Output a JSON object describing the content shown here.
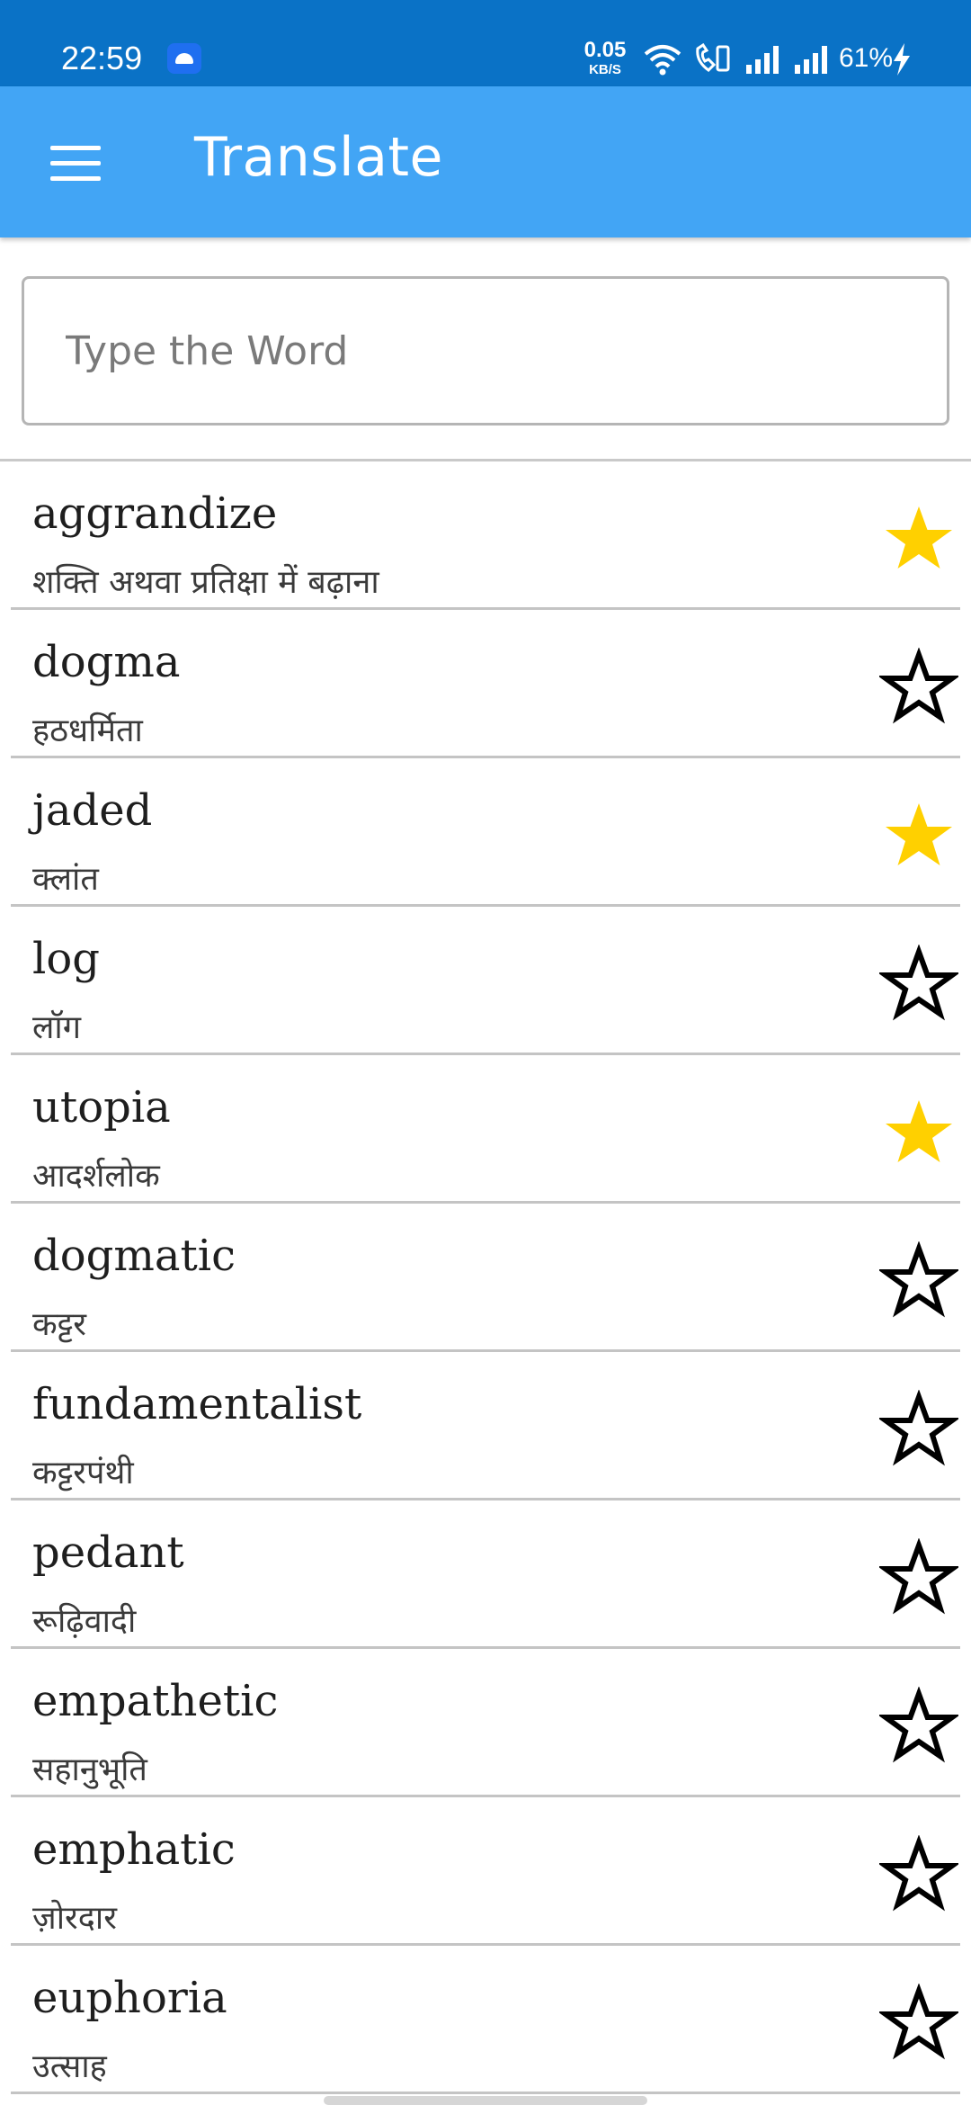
{
  "status_bar": {
    "time": "22:59",
    "speed_value": "0.05",
    "speed_unit": "KB/S",
    "battery": "61%"
  },
  "app_bar": {
    "title": "Translate",
    "menu_icon": "hamburger-menu-icon",
    "color": "#42a5f5"
  },
  "search": {
    "value": "",
    "placeholder": "Type the Word"
  },
  "colors": {
    "star_filled": "#ffd000",
    "star_outline": "#000000"
  },
  "words": [
    {
      "word": "aggrandize",
      "translation": "शक्ति अथवा प्रतिक्षा में बढ़ाना",
      "favorite": true
    },
    {
      "word": "dogma",
      "translation": "हठधर्मिता",
      "favorite": false
    },
    {
      "word": "jaded",
      "translation": "क्लांत",
      "favorite": true
    },
    {
      "word": "log",
      "translation": "लॉग",
      "favorite": false
    },
    {
      "word": "utopia",
      "translation": "आदर्शलोक",
      "favorite": true
    },
    {
      "word": "dogmatic",
      "translation": "कट्टर",
      "favorite": false
    },
    {
      "word": "fundamentalist",
      "translation": "कट्टरपंथी",
      "favorite": false
    },
    {
      "word": "pedant",
      "translation": "रूढ़िवादी",
      "favorite": false
    },
    {
      "word": "empathetic",
      "translation": "सहानुभूति",
      "favorite": false
    },
    {
      "word": "emphatic",
      "translation": "ज़ोरदार",
      "favorite": false
    },
    {
      "word": "euphoria",
      "translation": "उत्साह",
      "favorite": false
    }
  ]
}
